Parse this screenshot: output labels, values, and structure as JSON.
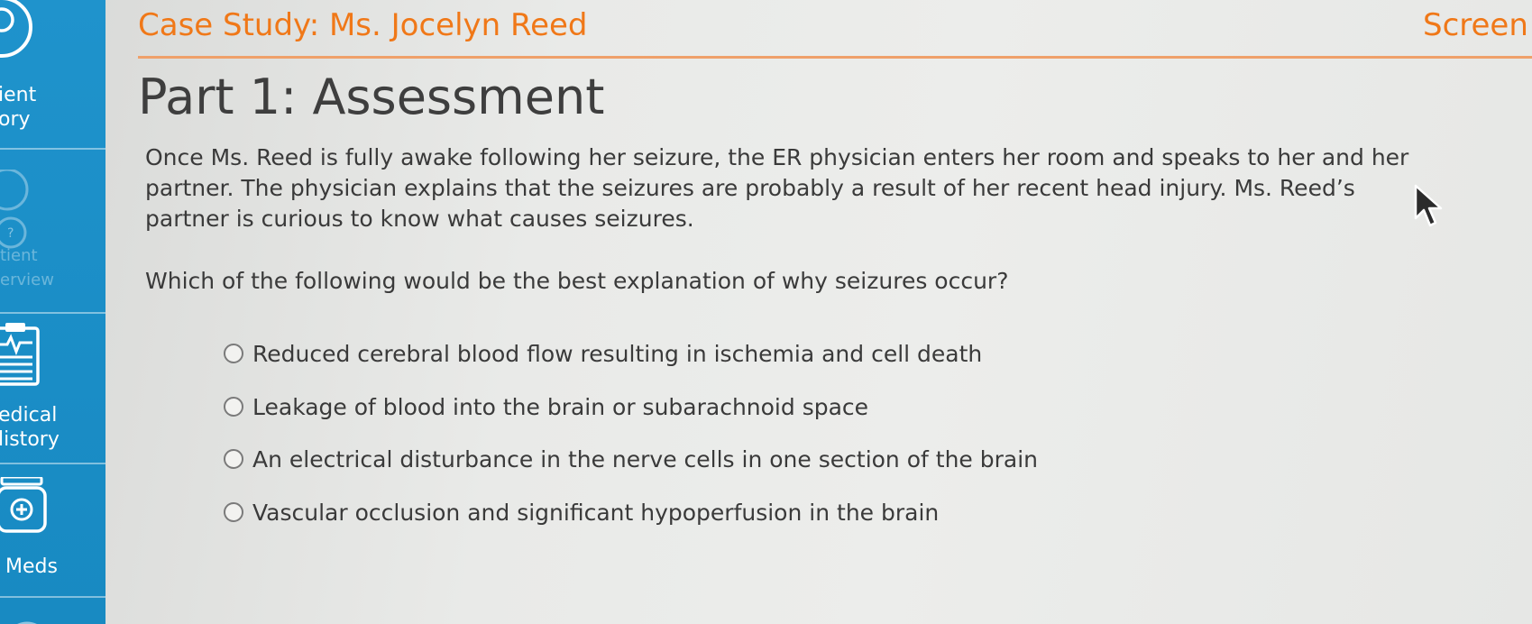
{
  "sidebar": {
    "items": [
      {
        "label": "ient\nory",
        "icon": "patient-icon"
      },
      {
        "label": "tient\nerview",
        "icon": "chat-question-icon"
      },
      {
        "label": "edical\nlistory",
        "icon": "clipboard-icon"
      },
      {
        "label": "Meds",
        "icon": "med-bottle-icon"
      }
    ]
  },
  "header": {
    "case_title": "Case Study: Ms. Jocelyn Reed",
    "screen_link": "Screen"
  },
  "main": {
    "part_title": "Part 1: Assessment",
    "scenario": "Once Ms. Reed is fully awake following her seizure, the ER physician enters her room and speaks to her and her partner. The physician explains that the seizures are probably a result of her recent head injury. Ms. Reed’s partner is curious to know what causes seizures.",
    "question": "Which of the following would be the best explanation of why seizures occur?",
    "options": [
      {
        "label": "Reduced cerebral blood flow resulting in ischemia and cell death"
      },
      {
        "label": "Leakage of blood into the brain or subarachnoid space"
      },
      {
        "label": "An electrical disturbance in the nerve cells in one section of the brain"
      },
      {
        "label": "Vascular occlusion and significant hypoperfusion in the brain"
      }
    ]
  },
  "colors": {
    "accent": "#f07818",
    "sidebar": "#1c90c9",
    "text": "#3a3a3a"
  }
}
